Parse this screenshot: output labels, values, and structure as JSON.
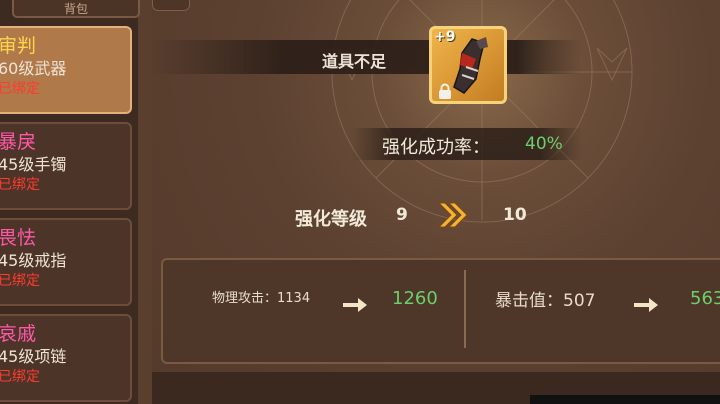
{
  "left_tab": {
    "label": "背包"
  },
  "equipment_list": [
    {
      "name": "审判",
      "level": "60级武器",
      "bound": "已绑定"
    },
    {
      "name": "暴戾",
      "level": "45级手镯",
      "bound": "已绑定"
    },
    {
      "name": "畏怯",
      "level": "45级戒指",
      "bound": "已绑定"
    },
    {
      "name": "哀戚",
      "level": "45级项链",
      "bound": "已绑定"
    }
  ],
  "banner": {
    "text": "道具不足"
  },
  "item": {
    "plus": "+9",
    "icon": "gauntlet-icon",
    "locked": true
  },
  "enhance": {
    "rate_label": "强化成功率：",
    "rate_value": "40%",
    "level_label": "强化等级",
    "level_current": "9",
    "level_next": "10"
  },
  "stats": {
    "attack_label": "物理攻击：1134",
    "attack_new": "1260",
    "crit_label": "暴击值：507",
    "crit_new": "563"
  },
  "colors": {
    "highlight": "#ffd44a",
    "name_pink": "#ff58a8",
    "bound_red": "#ff3a2e",
    "increase_green": "#6bd06b"
  }
}
